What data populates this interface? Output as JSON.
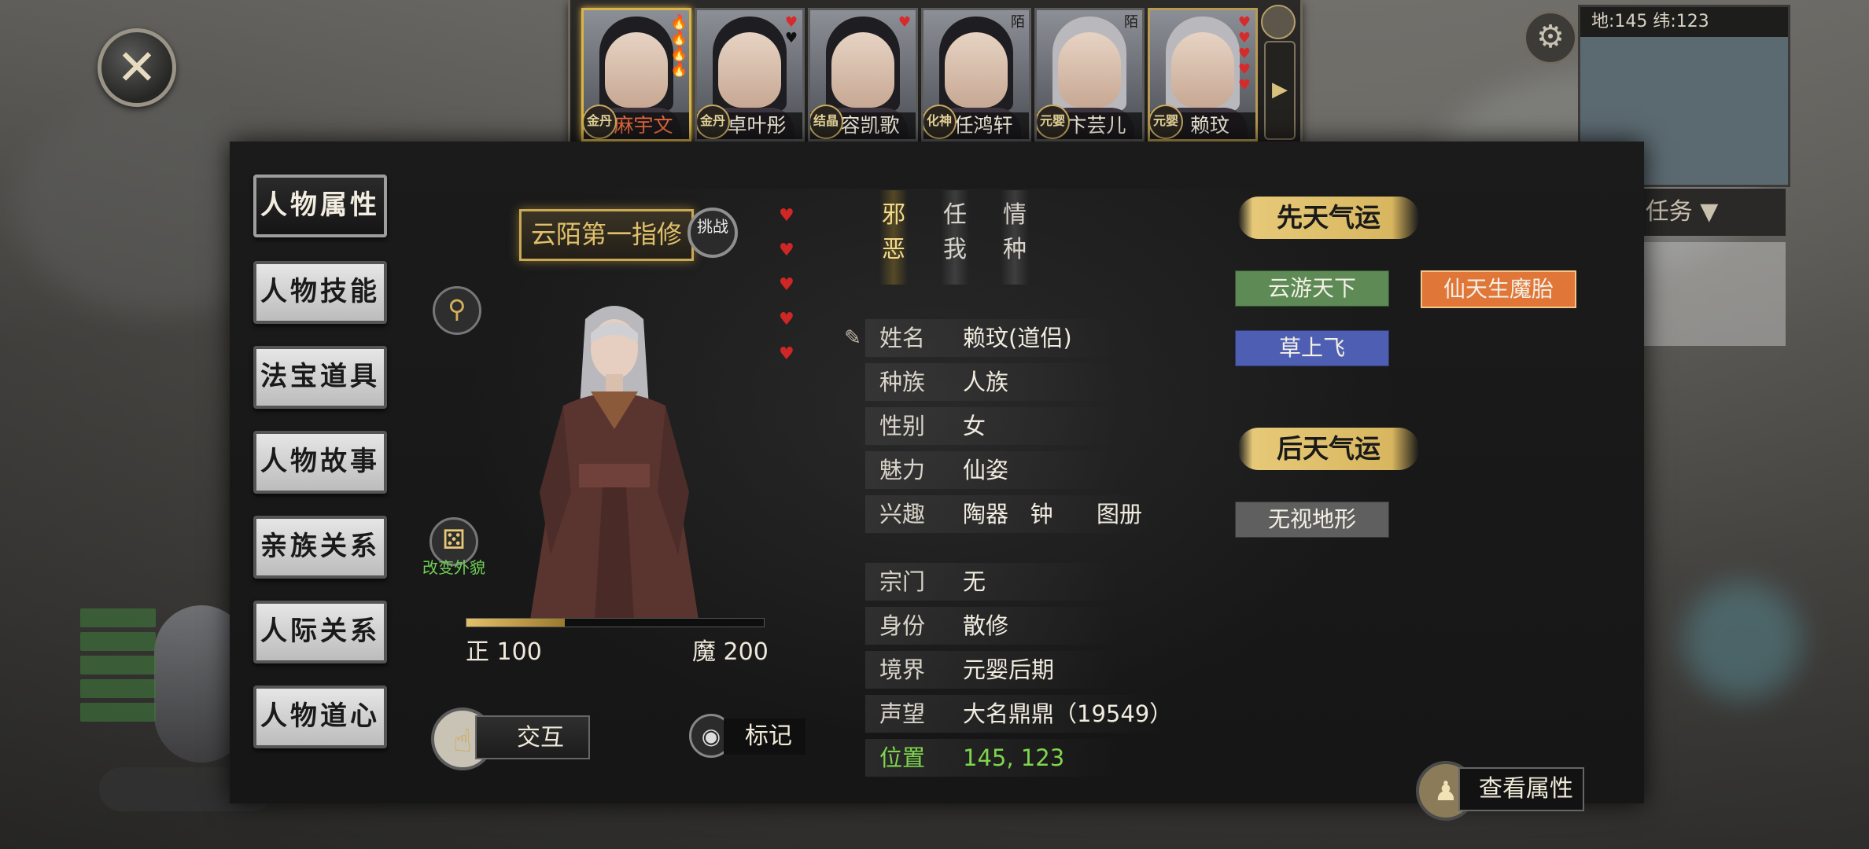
{
  "close_label": "✕",
  "character_bar": {
    "characters": [
      {
        "name": "麻宇文",
        "rank": "金丹",
        "selected": true
      },
      {
        "name": "卓叶彤",
        "rank": "金丹",
        "selected": false
      },
      {
        "name": "容凯歌",
        "rank": "结晶",
        "selected": false
      },
      {
        "name": "任鸿轩",
        "rank": "化神",
        "selected": false
      },
      {
        "name": "卞芸儿",
        "rank": "元婴",
        "selected": false
      },
      {
        "name": "赖玟",
        "rank": "元婴",
        "selected": false
      }
    ],
    "next_arrow": "▶"
  },
  "hud": {
    "minimap_header": "地:145 纬:123",
    "task_tab": "任务 ▼"
  },
  "nav": {
    "items": [
      "人物属性",
      "人物技能",
      "法宝道具",
      "人物故事",
      "亲族关系",
      "人际关系",
      "人物道心"
    ],
    "active_index": 0
  },
  "portrait": {
    "title": "云陌第一指修",
    "challenge": "挑战",
    "change_appearance": "改变外貌",
    "alignment": {
      "left_label": "正 100",
      "right_label": "魔 200",
      "fill_fraction": 0.33
    },
    "hearts_count": 5,
    "interact_label": "交互",
    "mark_label": "标记"
  },
  "traits": [
    {
      "text": "邪恶",
      "style": "evil"
    },
    {
      "text": "任我",
      "style": "plain"
    },
    {
      "text": "情种",
      "style": "plain"
    }
  ],
  "info": {
    "name_k": "姓名",
    "name_v": "赖玟(道侣)",
    "race_k": "种族",
    "race_v": "人族",
    "gender_k": "性别",
    "gender_v": "女",
    "charm_k": "魅力",
    "charm_v": "仙姿",
    "hobby_k": "兴趣",
    "hobby_v": "陶器   钟      图册",
    "sect_k": "宗门",
    "sect_v": "无",
    "status_k": "身份",
    "status_v": "散修",
    "realm_k": "境界",
    "realm_v": "元婴后期",
    "fame_k": "声望",
    "fame_v": "大名鼎鼎（19549）",
    "pos_k": "位置",
    "pos_v": "145, 123"
  },
  "luck": {
    "innate_title": "先天气运",
    "innate": [
      {
        "text": "云游天下",
        "color": "#5d8a55"
      },
      {
        "text": "仙天生魔胎",
        "color": "#e07638"
      },
      {
        "text": "草上飞",
        "color": "#4e5fb3"
      }
    ],
    "acquired_title": "后天气运",
    "acquired": [
      {
        "text": "无视地形",
        "color": "#5f5f5f"
      }
    ]
  },
  "view_attributes_label": "查看属性"
}
